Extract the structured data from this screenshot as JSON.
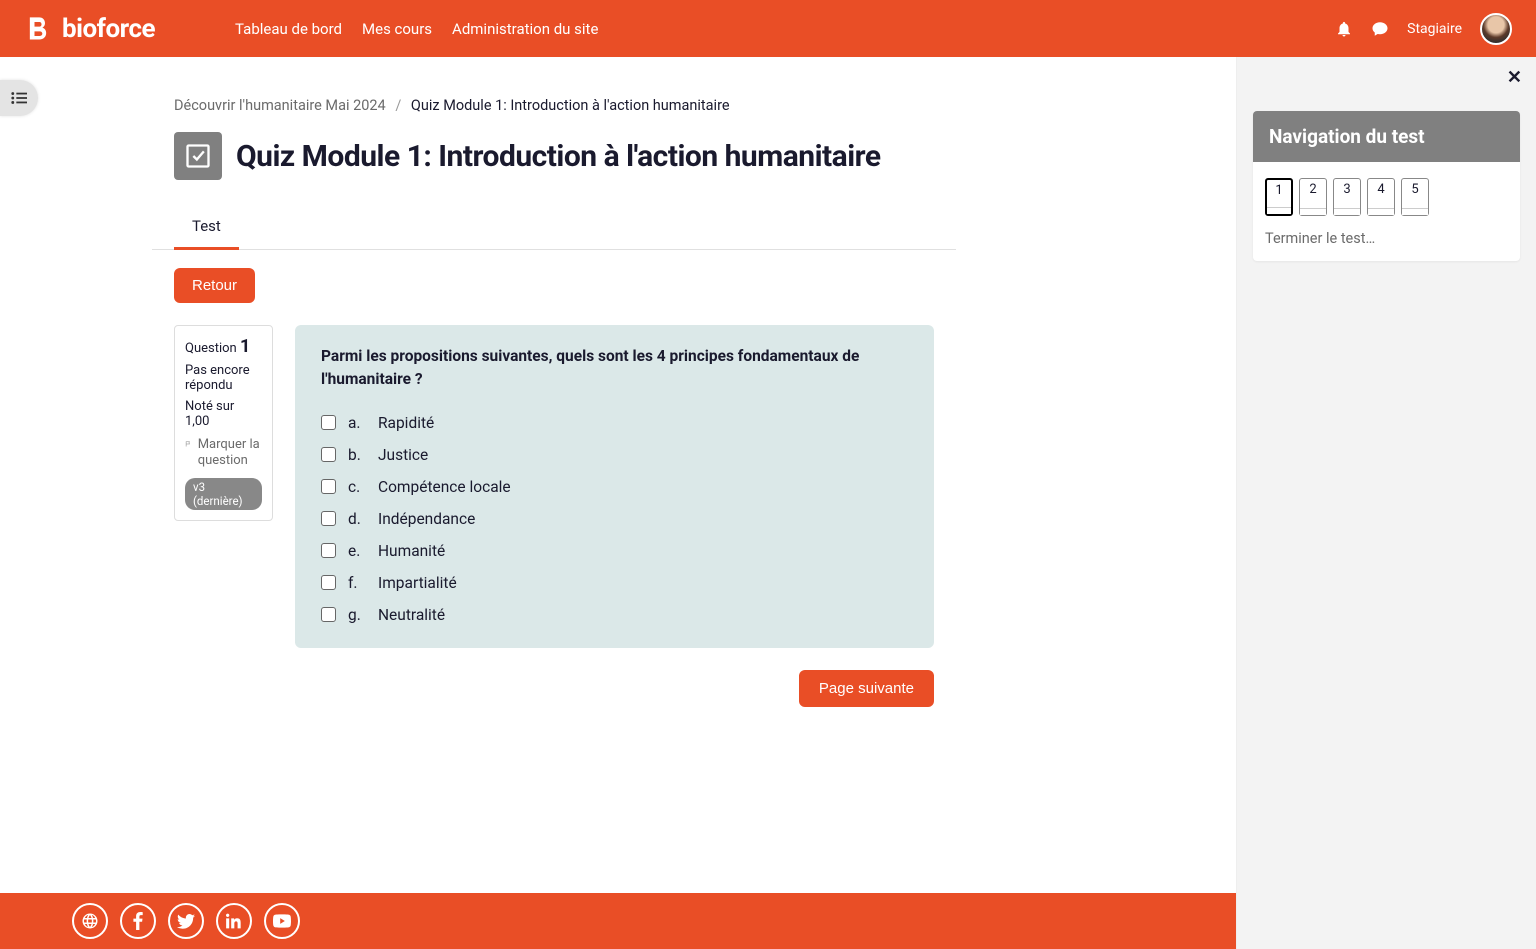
{
  "brand": "bioforce",
  "nav": {
    "dashboard": "Tableau de bord",
    "courses": "Mes cours",
    "admin": "Administration du site"
  },
  "role": "Stagiaire",
  "breadcrumb": {
    "course": "Découvrir l'humanitaire Mai 2024",
    "current": "Quiz Module 1: Introduction à l'action humanitaire"
  },
  "page_title": "Quiz Module 1: Introduction à l'action humanitaire",
  "tab_label": "Test",
  "back_label": "Retour",
  "question_info": {
    "label_prefix": "Question",
    "number": "1",
    "state": "Pas encore répondu",
    "grade": "Noté sur 1,00",
    "flag": "Marquer la question",
    "version": "v3 (dernière)"
  },
  "question_text": "Parmi les propositions suivantes, quels sont les 4 principes fondamentaux de l'humanitaire ?",
  "answers": [
    {
      "letter": "a.",
      "text": "Rapidité"
    },
    {
      "letter": "b.",
      "text": "Justice"
    },
    {
      "letter": "c.",
      "text": "Compétence locale"
    },
    {
      "letter": "d.",
      "text": "Indépendance"
    },
    {
      "letter": "e.",
      "text": "Humanité"
    },
    {
      "letter": "f.",
      "text": "Impartialité"
    },
    {
      "letter": "g.",
      "text": "Neutralité"
    }
  ],
  "next_label": "Page suivante",
  "quiz_nav": {
    "title": "Navigation du test",
    "items": [
      "1",
      "2",
      "3",
      "4",
      "5"
    ],
    "finish": "Terminer le test…"
  }
}
